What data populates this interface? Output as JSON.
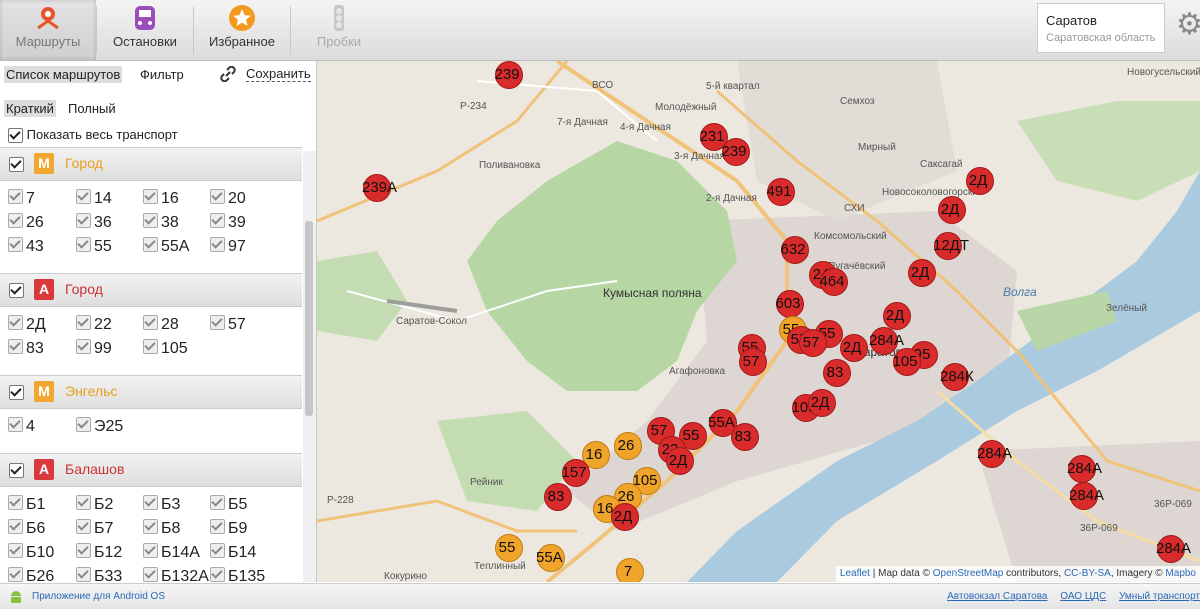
{
  "toolbar": {
    "items": [
      {
        "label": "Маршруты",
        "icon": "route-pin-icon"
      },
      {
        "label": "Остановки",
        "icon": "bus-stop-icon"
      },
      {
        "label": "Избранное",
        "icon": "star-icon"
      },
      {
        "label": "Пробки",
        "icon": "traffic-light-icon"
      }
    ],
    "city": "Саратов",
    "region": "Саратовская область",
    "settings_icon": "gear-icon"
  },
  "sidebar": {
    "tab_list": "Список маршрутов",
    "tab_filter": "Фильтр",
    "save_label": "Сохранить",
    "mode_short": "Краткий",
    "mode_full": "Полный",
    "show_all": "Показать весь транспорт",
    "groups": [
      {
        "badge": "М",
        "name": "Город",
        "routes": [
          "7",
          "14",
          "16",
          "20",
          "26",
          "36",
          "38",
          "39",
          "43",
          "55",
          "55А",
          "97"
        ]
      },
      {
        "badge": "А",
        "name": "Город",
        "routes": [
          "2Д",
          "22",
          "28",
          "57",
          "83",
          "99",
          "105"
        ]
      },
      {
        "badge": "М",
        "name": "Энгельс",
        "routes": [
          "4",
          "Э25"
        ]
      },
      {
        "badge": "А",
        "name": "Балашов",
        "routes": [
          "Б1",
          "Б2",
          "Б3",
          "Б5",
          "Б6",
          "Б7",
          "Б8",
          "Б9",
          "Б10",
          "Б12",
          "Б14А",
          "Б14",
          "Б26",
          "Б33",
          "Б132А",
          "Б135"
        ]
      }
    ]
  },
  "map": {
    "labels": [
      "ВСО",
      "Молодёжный",
      "5-й квартал",
      "Новогусельский",
      "Семхоз",
      "7-я Дачная",
      "4-я Дачная",
      "Поливановка",
      "3-я Дачная",
      "Мирный",
      "Саксагай",
      "2-я Дачная",
      "Новосоколовогорский",
      "СХИ",
      "Комсомольский",
      "Пугачёвский",
      "Кумысная поляна",
      "Саратов-Сокол",
      "Волга",
      "Зелёный",
      "Саратов",
      "Агафоновка",
      "Рейник",
      "Теплинный",
      "Кокурино",
      "Р-234",
      "Р-228",
      "36Р-069",
      "36Р-069"
    ],
    "markers": [
      "239",
      "239А",
      "231",
      "239",
      "491",
      "2Д",
      "2Д",
      "12ДТ",
      "632",
      "24",
      "464",
      "2Д",
      "603",
      "55",
      "2Д",
      "57",
      "55",
      "57",
      "2Д",
      "284А",
      "95",
      "105",
      "284К",
      "55",
      "57",
      "83",
      "105",
      "2Д",
      "55А",
      "83",
      "57",
      "55",
      "22",
      "26",
      "16",
      "157",
      "2Д",
      "105",
      "83",
      "26",
      "16",
      "2Д",
      "55",
      "55А",
      "7",
      "284А",
      "284А",
      "284А",
      "284А"
    ],
    "attribution": {
      "leaflet": "Leaflet",
      "text1": "| Map data ©",
      "osm": "OpenStreetMap",
      "text2": "contributors,",
      "license": "CC-BY-SA",
      "text3": ", Imagery ©",
      "mapbox": "Mapbo"
    }
  },
  "footer": {
    "android": "Приложение для Android OS",
    "links": [
      "Автовокзал Саратова",
      "ОАО ЦДС",
      "Умный транспорт"
    ]
  },
  "colors": {
    "red_marker": "#d92b2b",
    "orange_marker": "#f0a42a",
    "accent_orange": "#e8a020",
    "accent_red": "#cc3333"
  }
}
